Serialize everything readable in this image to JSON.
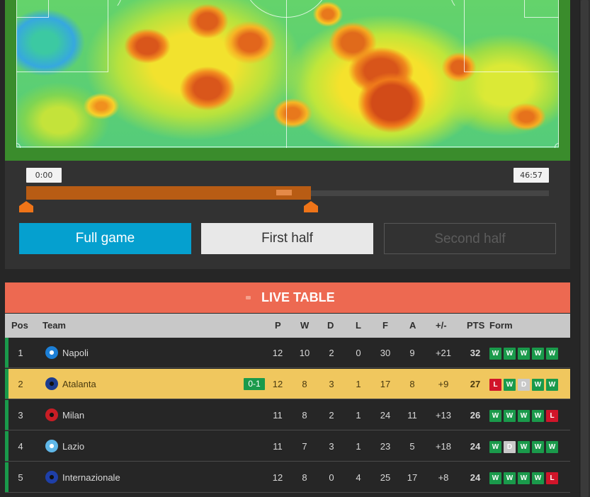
{
  "heatmap": {
    "time_start": "0:00",
    "time_end": "46:57",
    "range_start_fraction": 0.0,
    "range_end_fraction": 0.545
  },
  "period_buttons": {
    "full_game": "Full game",
    "first_half": "First half",
    "second_half": "Second half",
    "active": "Full game"
  },
  "live_table": {
    "title": "LIVE TABLE",
    "columns": {
      "pos": "Pos",
      "team": "Team",
      "p": "P",
      "w": "W",
      "d": "D",
      "l": "L",
      "f": "F",
      "a": "A",
      "gd": "+/-",
      "pts": "PTS",
      "form": "Form"
    },
    "rows": [
      {
        "pos": "1",
        "team": "Napoli",
        "crest_icon": "napoli-crest-icon",
        "live_score": "",
        "p": "12",
        "w": "10",
        "d": "2",
        "l": "0",
        "f": "30",
        "a": "9",
        "gd": "+21",
        "pts": "32",
        "form": [
          "W",
          "W",
          "W",
          "W",
          "W"
        ],
        "highlight": false
      },
      {
        "pos": "2",
        "team": "Atalanta",
        "crest_icon": "atalanta-crest-icon",
        "live_score": "0-1",
        "p": "12",
        "w": "8",
        "d": "3",
        "l": "1",
        "f": "17",
        "a": "8",
        "gd": "+9",
        "pts": "27",
        "form": [
          "L",
          "W",
          "D",
          "W",
          "W"
        ],
        "highlight": true
      },
      {
        "pos": "3",
        "team": "Milan",
        "crest_icon": "milan-crest-icon",
        "live_score": "",
        "p": "11",
        "w": "8",
        "d": "2",
        "l": "1",
        "f": "24",
        "a": "11",
        "gd": "+13",
        "pts": "26",
        "form": [
          "W",
          "W",
          "W",
          "W",
          "L"
        ],
        "highlight": false
      },
      {
        "pos": "4",
        "team": "Lazio",
        "crest_icon": "lazio-crest-icon",
        "live_score": "",
        "p": "11",
        "w": "7",
        "d": "3",
        "l": "1",
        "f": "23",
        "a": "5",
        "gd": "+18",
        "pts": "24",
        "form": [
          "W",
          "D",
          "W",
          "W",
          "W"
        ],
        "highlight": false
      },
      {
        "pos": "5",
        "team": "Internazionale",
        "crest_icon": "inter-crest-icon",
        "live_score": "",
        "p": "12",
        "w": "8",
        "d": "0",
        "l": "4",
        "f": "25",
        "a": "17",
        "gd": "+8",
        "pts": "24",
        "form": [
          "W",
          "W",
          "W",
          "W",
          "L"
        ],
        "highlight": false
      }
    ]
  },
  "colors": {
    "accent_orange": "#ef7418",
    "live_header": "#ed6951",
    "full_game_button": "#05a0cf",
    "form_win": "#1a9a4b",
    "form_loss": "#d1152a",
    "form_draw": "#c9c9c9",
    "highlight_row": "#f0c75e"
  }
}
